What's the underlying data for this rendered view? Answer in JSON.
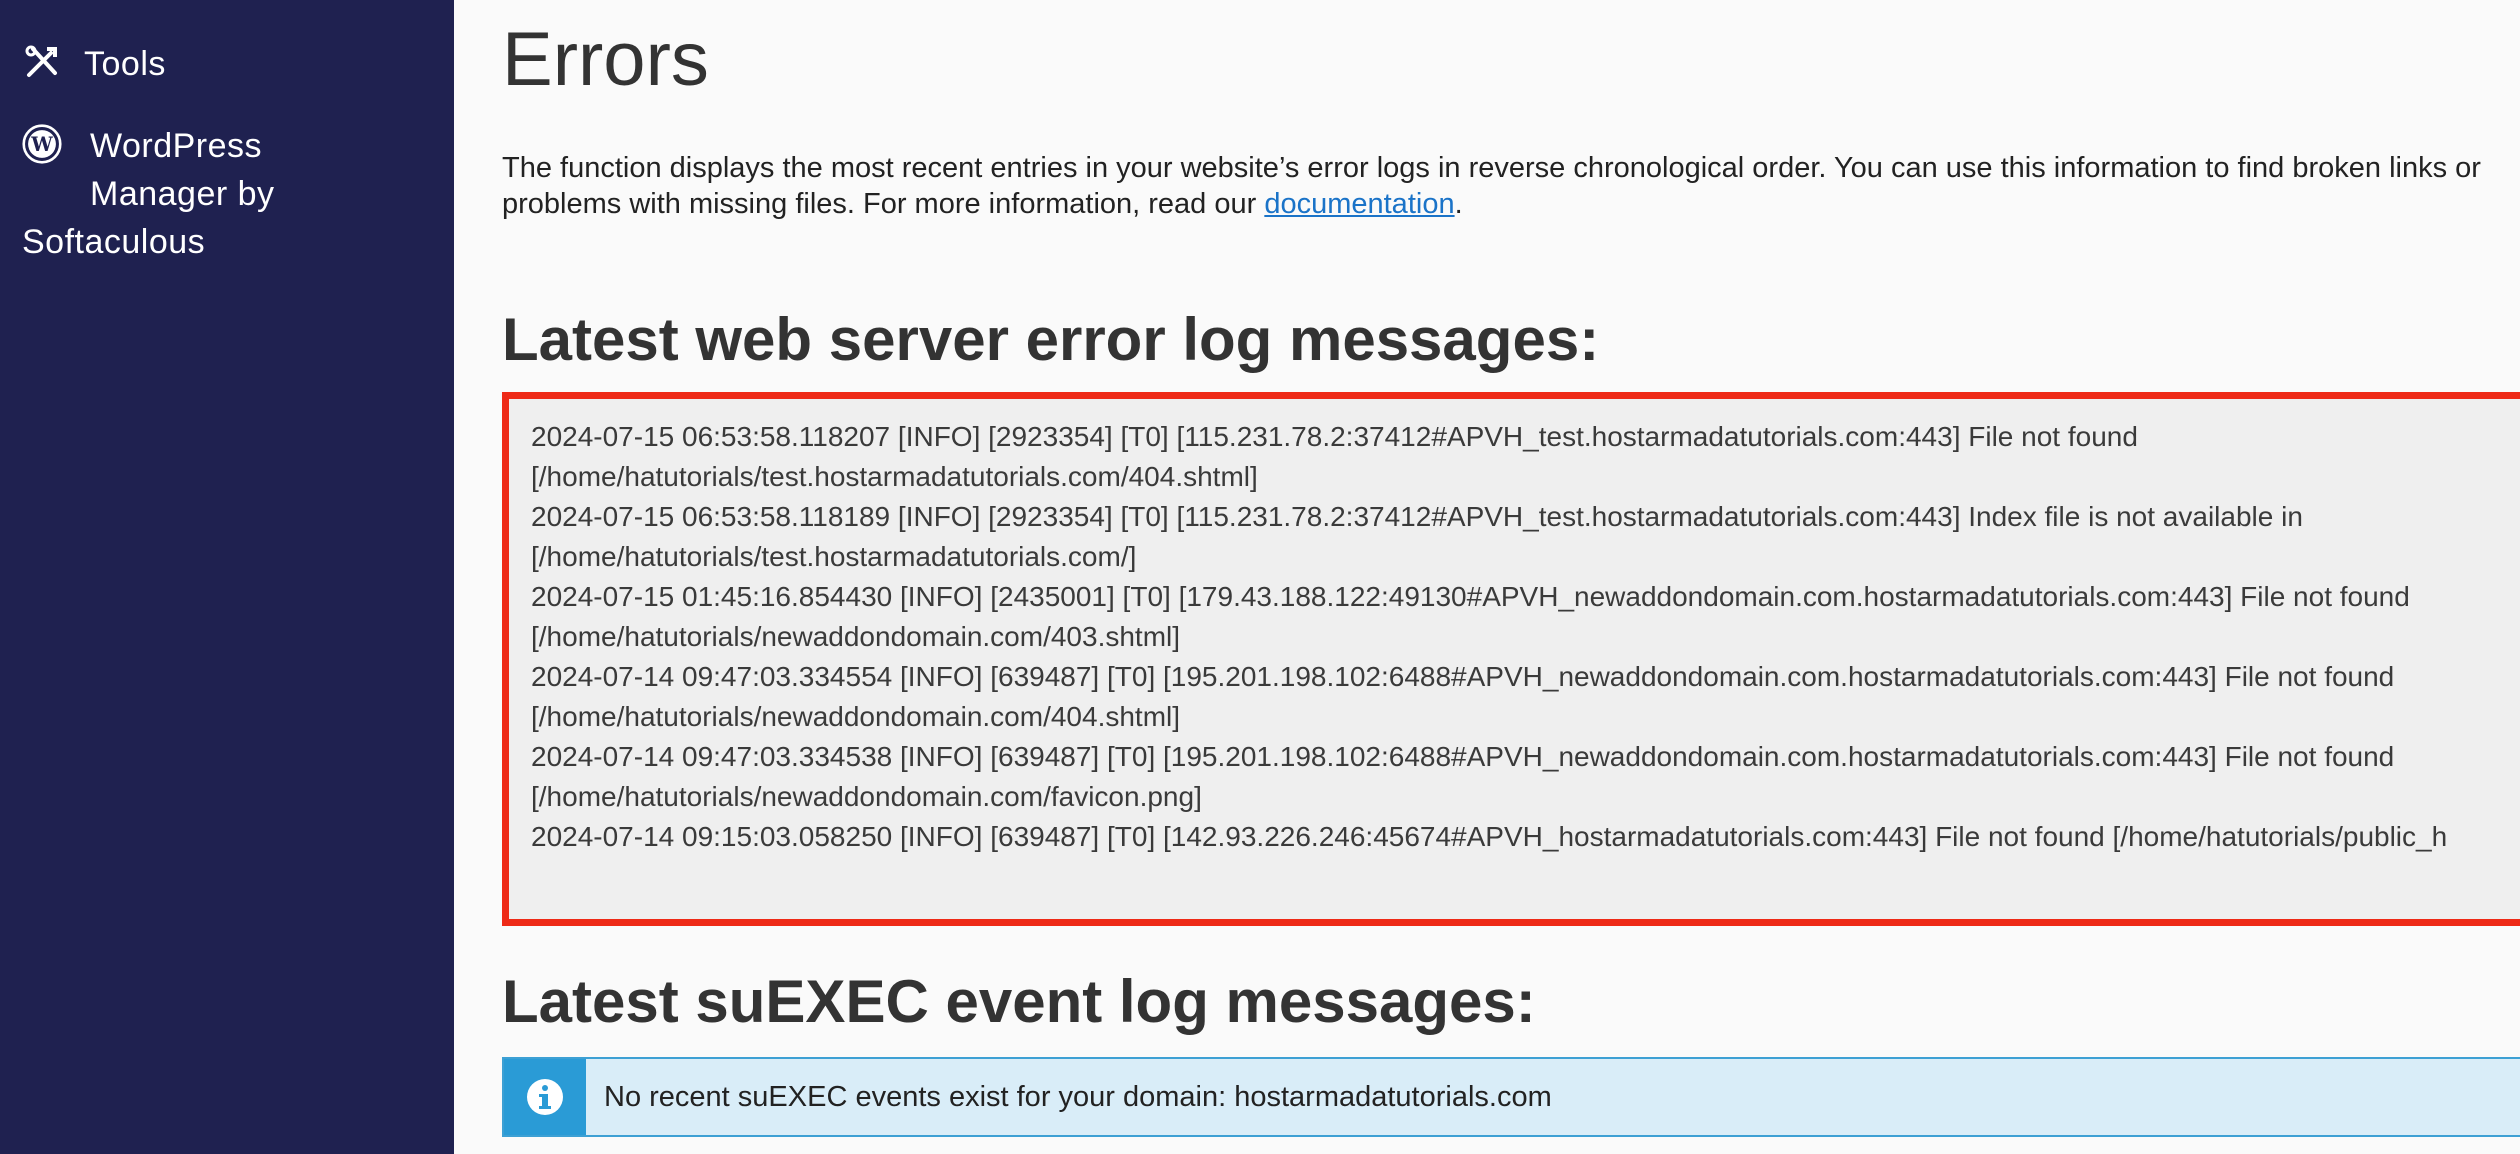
{
  "sidebar": {
    "items": [
      {
        "label": "Tools",
        "icon": "tools-icon"
      },
      {
        "label_line1": "WordPress",
        "label_line2": "Manager by",
        "label_line3": "Softaculous",
        "icon": "wordpress-icon"
      }
    ],
    "background": "#1f2150"
  },
  "page": {
    "title": "Errors",
    "description_text": "The function displays the most recent entries in your website’s error logs in reverse chronological order. You can use this information to find broken links or problems with missing files. For more information, read our ",
    "documentation_link": "documentation",
    "description_end": "."
  },
  "error_log": {
    "heading": "Latest web server error log messages:",
    "highlight_color": "#ee2a17",
    "lines": [
      "2024-07-15 06:53:58.118207 [INFO] [2923354] [T0] [115.231.78.2:37412#APVH_test.hostarmadatutorials.com:443] File not found [/home/hatutorials/test.hostarmadatutorials.com/404.shtml]",
      "2024-07-15 06:53:58.118189 [INFO] [2923354] [T0] [115.231.78.2:37412#APVH_test.hostarmadatutorials.com:443] Index file is not available in [/home/hatutorials/test.hostarmadatutorials.com/]",
      "2024-07-15 01:45:16.854430 [INFO] [2435001] [T0] [179.43.188.122:49130#APVH_newaddondomain.com.hostarmadatutorials.com:443] File not found [/home/hatutorials/newaddondomain.com/403.shtml]",
      "2024-07-14 09:47:03.334554 [INFO] [639487] [T0] [195.201.198.102:6488#APVH_newaddondomain.com.hostarmadatutorials.com:443] File not found [/home/hatutorials/newaddondomain.com/404.shtml]",
      "2024-07-14 09:47:03.334538 [INFO] [639487] [T0] [195.201.198.102:6488#APVH_newaddondomain.com.hostarmadatutorials.com:443] File not found [/home/hatutorials/newaddondomain.com/favicon.png]",
      "2024-07-14 09:15:03.058250 [INFO] [639487] [T0] [142.93.226.246:45674#APVH_hostarmadatutorials.com:443] File not found [/home/hatutorials/public_h"
    ]
  },
  "suexec_log": {
    "heading": "Latest suEXEC event log messages:",
    "notice_icon": "info-icon",
    "notice_text": "No recent suEXEC events exist for your domain: hostarmadatutorials.com"
  }
}
